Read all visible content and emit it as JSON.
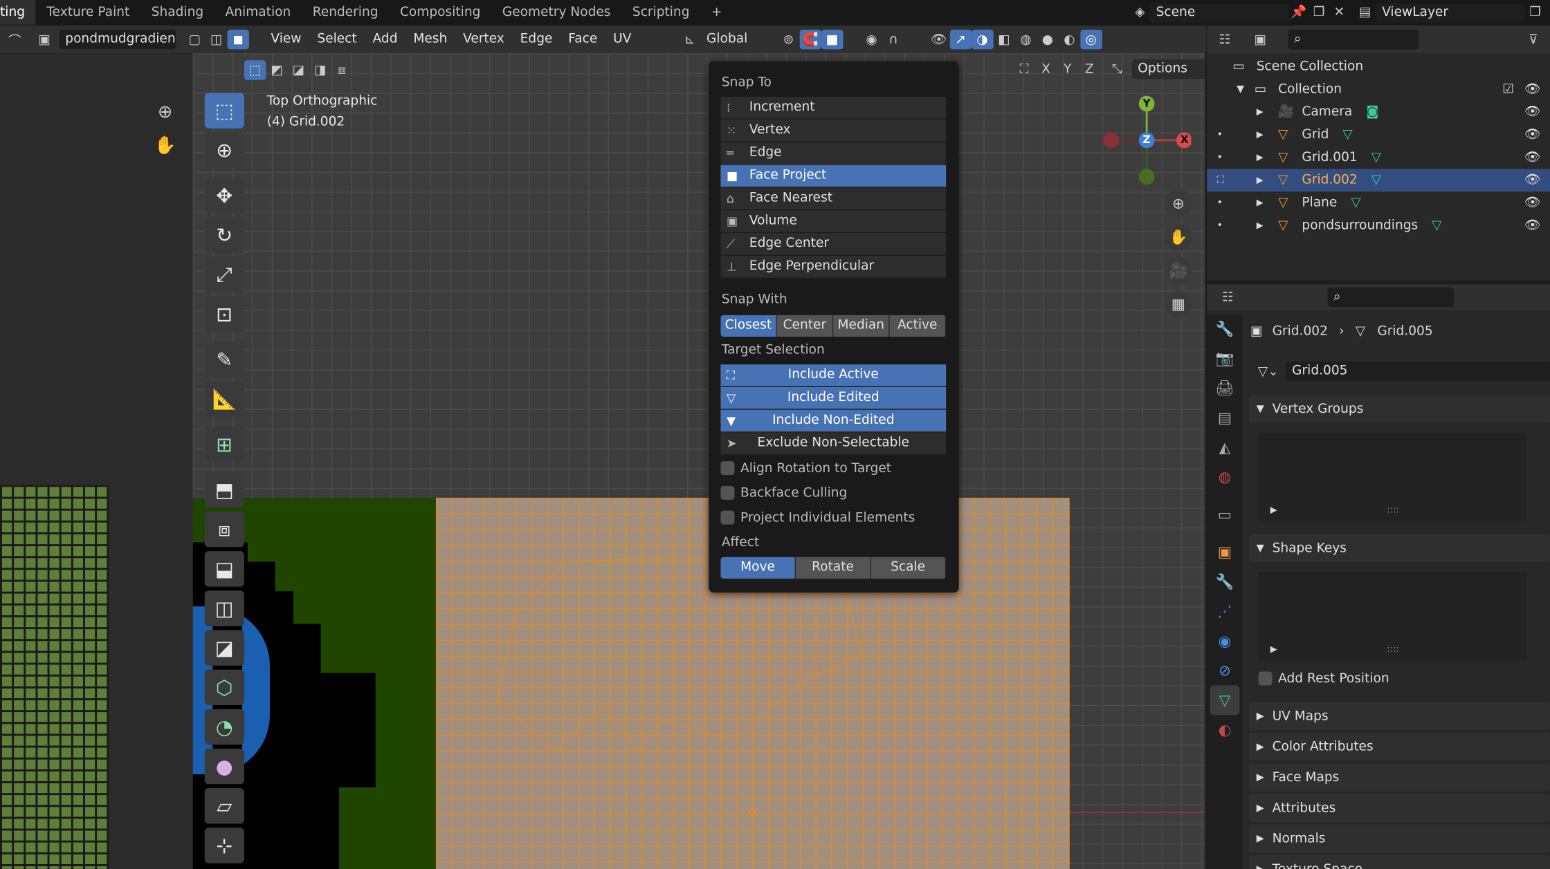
{
  "topbar": {
    "tabs": [
      "ting",
      "Texture Paint",
      "Shading",
      "Animation",
      "Rendering",
      "Compositing",
      "Geometry Nodes",
      "Scripting"
    ],
    "add_tab": "+",
    "scene": "Scene",
    "view_layer": "ViewLayer"
  },
  "header": {
    "image_name": "pondmudgradient.p",
    "menus": [
      "View",
      "Select",
      "Add",
      "Mesh",
      "Vertex",
      "Edge",
      "Face",
      "UV"
    ],
    "orientation": "Global",
    "options": "Options",
    "axes": [
      "X",
      "Y",
      "Z"
    ]
  },
  "viewport": {
    "view_name": "Top Orthographic",
    "object_name": "(4) Grid.002",
    "gizmo": {
      "y": "Y",
      "z": "Z",
      "x": "X"
    }
  },
  "snap_popup": {
    "snap_to_title": "Snap To",
    "snap_to": [
      {
        "label": "Increment",
        "icon": "increment-icon",
        "glyph": "⁞",
        "selected": false
      },
      {
        "label": "Vertex",
        "icon": "vertex-icon",
        "glyph": "⁙",
        "selected": false
      },
      {
        "label": "Edge",
        "icon": "edge-icon",
        "glyph": "═",
        "selected": false
      },
      {
        "label": "Face Project",
        "icon": "face-project-icon",
        "glyph": "■",
        "selected": true
      },
      {
        "label": "Face Nearest",
        "icon": "face-nearest-icon",
        "glyph": "⌂",
        "selected": false
      },
      {
        "label": "Volume",
        "icon": "volume-icon",
        "glyph": "▣",
        "selected": false
      },
      {
        "label": "Edge Center",
        "icon": "edge-center-icon",
        "glyph": "⟋",
        "selected": false
      },
      {
        "label": "Edge Perpendicular",
        "icon": "edge-perpendicular-icon",
        "glyph": "⊥",
        "selected": false
      }
    ],
    "snap_with_title": "Snap With",
    "snap_with": [
      "Closest",
      "Center",
      "Median",
      "Active"
    ],
    "snap_with_selected": "Closest",
    "target_title": "Target Selection",
    "target": [
      {
        "label": "Include Active",
        "glyph": "⛶",
        "selected": true
      },
      {
        "label": "Include Edited",
        "glyph": "▽",
        "selected": true
      },
      {
        "label": "Include Non-Edited",
        "glyph": "▼",
        "selected": true
      },
      {
        "label": "Exclude Non-Selectable",
        "glyph": "➤",
        "selected": false
      }
    ],
    "checks": [
      "Align Rotation to Target",
      "Backface Culling",
      "Project Individual Elements"
    ],
    "affect_title": "Affect",
    "affect": [
      "Move",
      "Rotate",
      "Scale"
    ],
    "affect_selected": "Move"
  },
  "outliner": {
    "scene_collection": "Scene Collection",
    "collection": "Collection",
    "items": [
      {
        "name": "Camera",
        "icon": "camera-icon",
        "selected": false
      },
      {
        "name": "Grid",
        "icon": "mesh-icon",
        "selected": false
      },
      {
        "name": "Grid.001",
        "icon": "mesh-icon",
        "selected": false
      },
      {
        "name": "Grid.002",
        "icon": "mesh-icon",
        "selected": true
      },
      {
        "name": "Plane",
        "icon": "mesh-icon",
        "selected": false
      },
      {
        "name": "pondsurroundings",
        "icon": "mesh-icon",
        "selected": false
      }
    ]
  },
  "properties": {
    "breadcrumb_object": "Grid.002",
    "breadcrumb_mesh": "Grid.005",
    "mesh_name": "Grid.005",
    "panels": {
      "vertex_groups": "Vertex Groups",
      "shape_keys": "Shape Keys",
      "add_rest_position": "Add Rest Position",
      "uv_maps": "UV Maps",
      "color_attributes": "Color Attributes",
      "face_maps": "Face Maps",
      "attributes": "Attributes",
      "normals": "Normals",
      "texture_space": "Texture Space"
    }
  },
  "colors": {
    "accent": "#4772b3",
    "mesh_orange": "#e89a3c",
    "mesh_face": "#a38f7e",
    "grass_green": "#5d7f39",
    "dark_green": "#1f4500",
    "water_blue": "#1a5fb0",
    "mesh_data_green": "#3ec8a0"
  }
}
